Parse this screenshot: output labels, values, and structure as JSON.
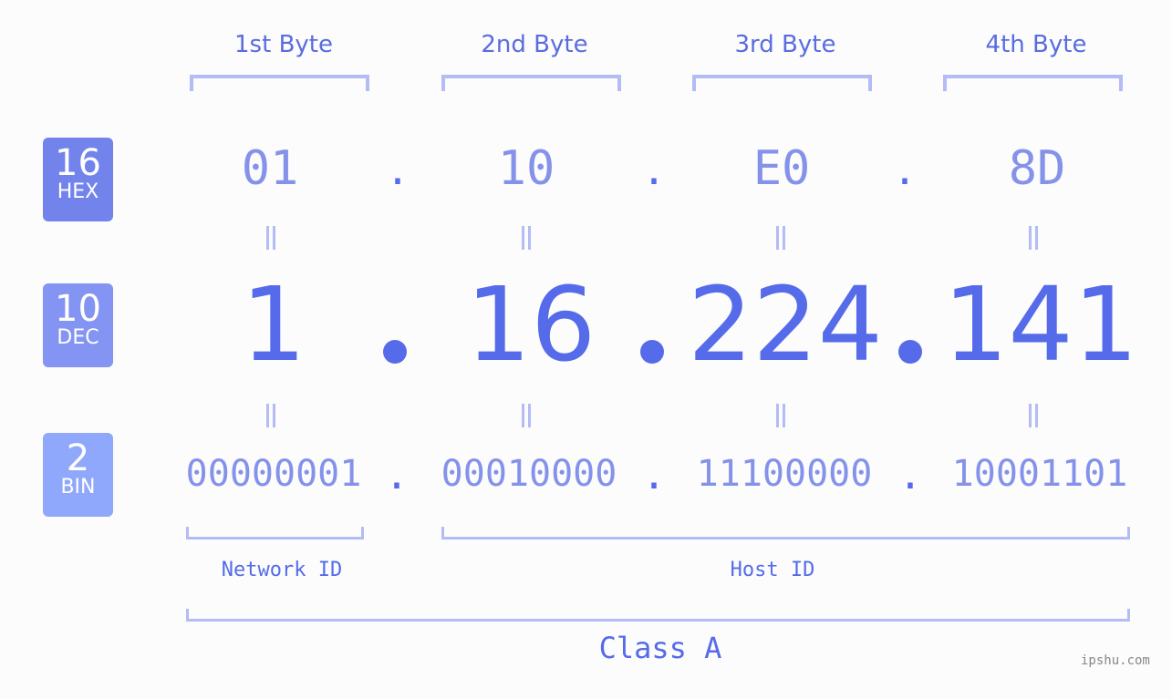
{
  "colors": {
    "hex_badge": "#7383ec",
    "dec_badge": "#8494f2",
    "bin_badge": "#90a8fb",
    "accent": "#566be9",
    "muted_text": "#8592ea",
    "bracket": "#b3bcf4"
  },
  "byte_headers": [
    "1st Byte",
    "2nd Byte",
    "3rd Byte",
    "4th Byte"
  ],
  "badges": {
    "hex": {
      "number": "16",
      "label": "HEX"
    },
    "dec": {
      "number": "10",
      "label": "DEC"
    },
    "bin": {
      "number": "2",
      "label": "BIN"
    }
  },
  "hex_values": [
    "01",
    "10",
    "E0",
    "8D"
  ],
  "dec_values": [
    "1",
    "16",
    "224",
    "141"
  ],
  "bin_values": [
    "00000001",
    "00010000",
    "11100000",
    "10001101"
  ],
  "separator": ".",
  "network_id_label": "Network ID",
  "host_id_label": "Host ID",
  "class_label": "Class A",
  "watermark": "ipshu.com"
}
